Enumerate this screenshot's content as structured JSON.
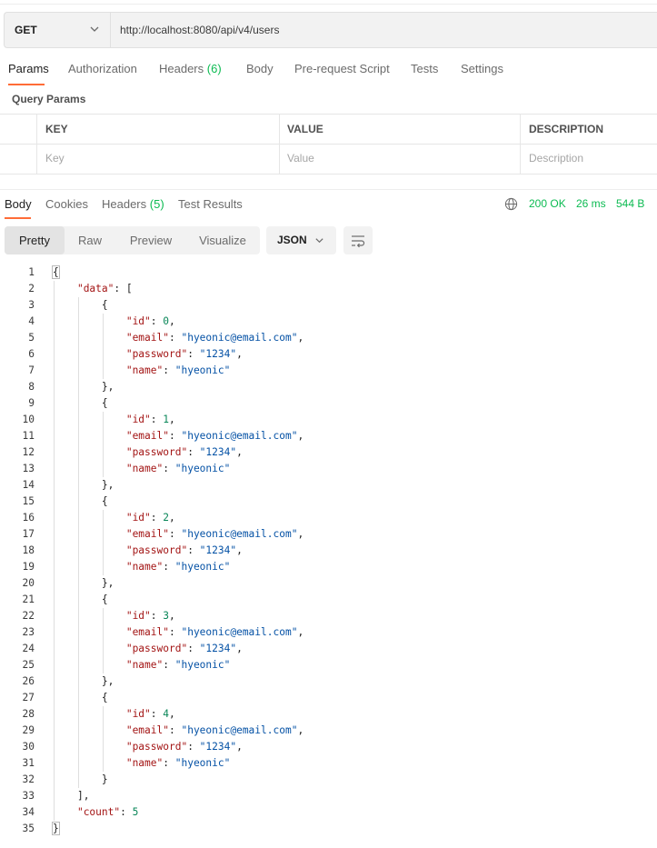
{
  "request": {
    "method": "GET",
    "url": "http://localhost:8080/api/v4/users"
  },
  "request_tabs": [
    {
      "label": "Params",
      "active": true
    },
    {
      "label": "Authorization"
    },
    {
      "label": "Headers",
      "count": "(6)"
    },
    {
      "label": "Body"
    },
    {
      "label": "Pre-request Script"
    },
    {
      "label": "Tests"
    },
    {
      "label": "Settings"
    }
  ],
  "query_params": {
    "title": "Query Params",
    "columns": [
      "KEY",
      "VALUE",
      "DESCRIPTION"
    ],
    "placeholders": [
      "Key",
      "Value",
      "Description"
    ]
  },
  "response_tabs": [
    {
      "label": "Body",
      "active": true
    },
    {
      "label": "Cookies"
    },
    {
      "label": "Headers",
      "count": "(5)"
    },
    {
      "label": "Test Results"
    }
  ],
  "response_status": {
    "status": "200 OK",
    "time": "26 ms",
    "size": "544 B",
    "color": "#0cbb52"
  },
  "view_modes": [
    "Pretty",
    "Raw",
    "Preview",
    "Visualize"
  ],
  "format": "JSON",
  "icons": [
    "chevron-down-icon",
    "globe-icon",
    "wrap-lines-icon"
  ],
  "accent_color": "#ff6c37",
  "code_lines": [
    "{",
    "    \"data\": [",
    "        {",
    "            \"id\": 0,",
    "            \"email\": \"hyeonic@email.com\",",
    "            \"password\": \"1234\",",
    "            \"name\": \"hyeonic\"",
    "        },",
    "        {",
    "            \"id\": 1,",
    "            \"email\": \"hyeonic@email.com\",",
    "            \"password\": \"1234\",",
    "            \"name\": \"hyeonic\"",
    "        },",
    "        {",
    "            \"id\": 2,",
    "            \"email\": \"hyeonic@email.com\",",
    "            \"password\": \"1234\",",
    "            \"name\": \"hyeonic\"",
    "        },",
    "        {",
    "            \"id\": 3,",
    "            \"email\": \"hyeonic@email.com\",",
    "            \"password\": \"1234\",",
    "            \"name\": \"hyeonic\"",
    "        },",
    "        {",
    "            \"id\": 4,",
    "            \"email\": \"hyeonic@email.com\",",
    "            \"password\": \"1234\",",
    "            \"name\": \"hyeonic\"",
    "        }",
    "    ],",
    "    \"count\": 5",
    "}"
  ]
}
